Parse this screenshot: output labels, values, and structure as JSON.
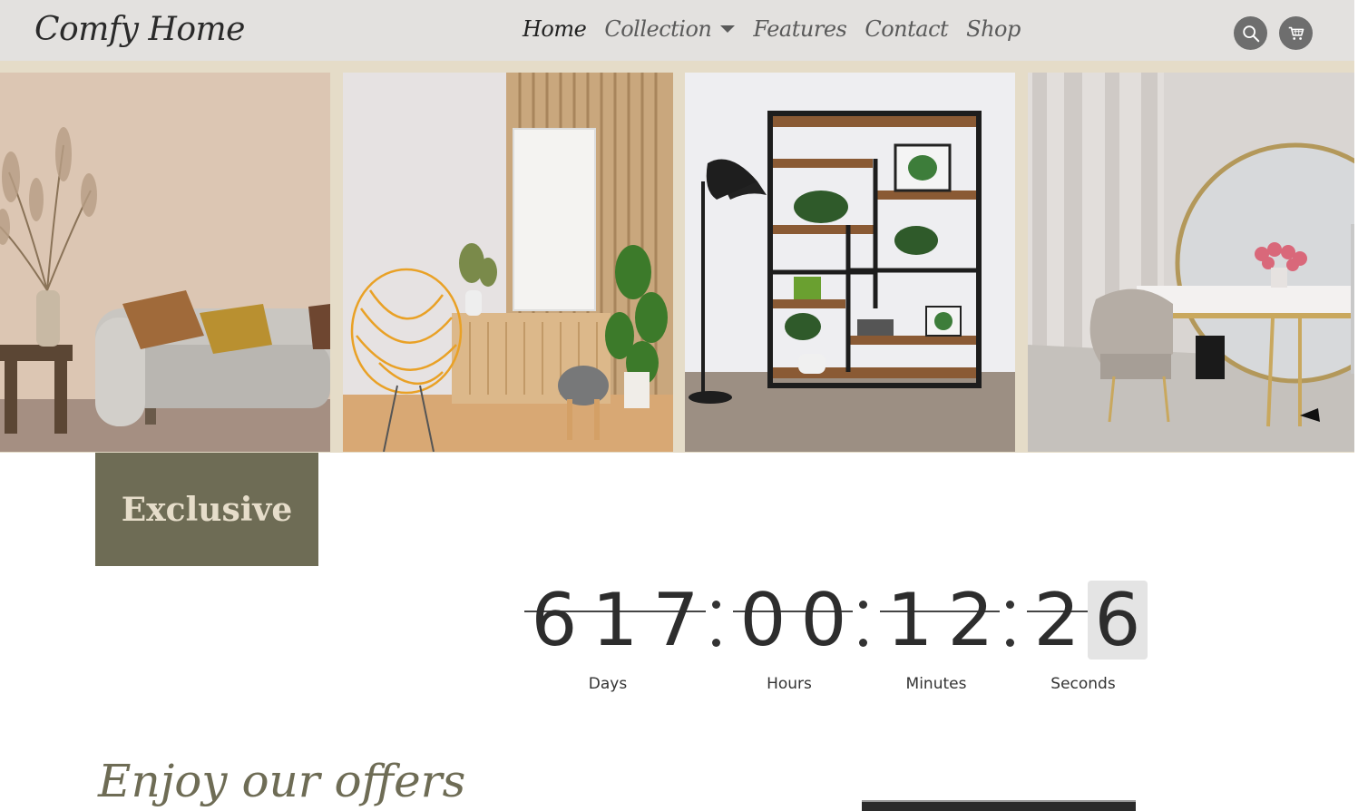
{
  "navbar": {
    "brand": "Comfy Home",
    "links": [
      {
        "label": "Home"
      },
      {
        "label": "Collection"
      },
      {
        "label": "Features"
      },
      {
        "label": "Contact"
      },
      {
        "label": "Shop"
      }
    ],
    "icons": [
      "search-icon",
      "cart-icon"
    ]
  },
  "gallery": {
    "panels": [
      "living-room-sofa",
      "armchair-sideboard",
      "black-shelf-plants",
      "vanity-mirror-room"
    ]
  },
  "badge": {
    "label": "Exclusive"
  },
  "countdown": {
    "days": "617",
    "hours": "00",
    "minutes": "12",
    "seconds": "26",
    "labels": {
      "days": "Days",
      "hours": "Hours",
      "minutes": "Minutes",
      "seconds": "Seconds"
    }
  },
  "offers": {
    "title": "Enjoy our offers"
  },
  "colors": {
    "navbar_bg": "#e3e1df",
    "accent_olive": "#6e6c55",
    "badge_text": "#e6ddca",
    "icon_bg": "#6e6e6e"
  }
}
